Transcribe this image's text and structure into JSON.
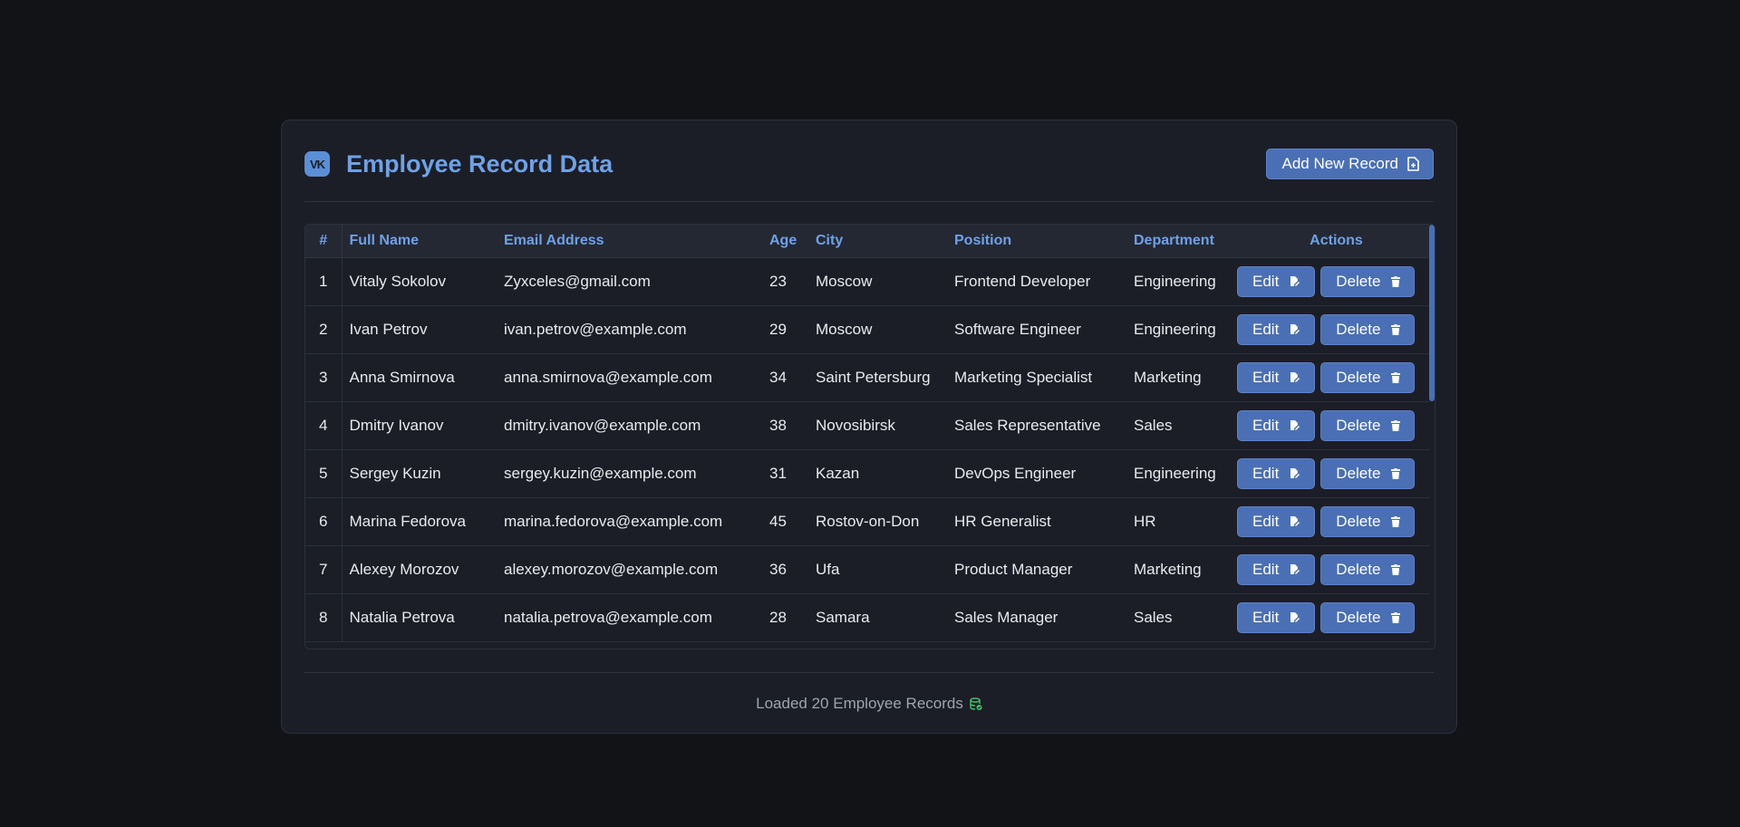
{
  "header": {
    "logo_text": "VK",
    "title": "Employee Record Data",
    "add_button_label": "Add New Record"
  },
  "table": {
    "columns": [
      "#",
      "Full Name",
      "Email Address",
      "Age",
      "City",
      "Position",
      "Department",
      "Actions"
    ],
    "edit_label": "Edit",
    "delete_label": "Delete",
    "rows": [
      {
        "num": "1",
        "name": "Vitaly Sokolov",
        "email": "Zyxceles@gmail.com",
        "age": "23",
        "city": "Moscow",
        "position": "Frontend Developer",
        "department": "Engineering"
      },
      {
        "num": "2",
        "name": "Ivan Petrov",
        "email": "ivan.petrov@example.com",
        "age": "29",
        "city": "Moscow",
        "position": "Software Engineer",
        "department": "Engineering"
      },
      {
        "num": "3",
        "name": "Anna Smirnova",
        "email": "anna.smirnova@example.com",
        "age": "34",
        "city": "Saint Petersburg",
        "position": "Marketing Specialist",
        "department": "Marketing"
      },
      {
        "num": "4",
        "name": "Dmitry Ivanov",
        "email": "dmitry.ivanov@example.com",
        "age": "38",
        "city": "Novosibirsk",
        "position": "Sales Representative",
        "department": "Sales"
      },
      {
        "num": "5",
        "name": "Sergey Kuzin",
        "email": "sergey.kuzin@example.com",
        "age": "31",
        "city": "Kazan",
        "position": "DevOps Engineer",
        "department": "Engineering"
      },
      {
        "num": "6",
        "name": "Marina Fedorova",
        "email": "marina.fedorova@example.com",
        "age": "45",
        "city": "Rostov-on-Don",
        "position": "HR Generalist",
        "department": "HR"
      },
      {
        "num": "7",
        "name": "Alexey Morozov",
        "email": "alexey.morozov@example.com",
        "age": "36",
        "city": "Ufa",
        "position": "Product Manager",
        "department": "Marketing"
      },
      {
        "num": "8",
        "name": "Natalia Petrova",
        "email": "natalia.petrova@example.com",
        "age": "28",
        "city": "Samara",
        "position": "Sales Manager",
        "department": "Sales"
      }
    ]
  },
  "footer": {
    "status_text": "Loaded 20 Employee Records",
    "status_icon": "database-check-icon"
  },
  "colors": {
    "accent": "#6fa1e6",
    "button": "#4a6fb5",
    "success": "#3ec46d",
    "background": "#121317",
    "card": "#1b1e26"
  }
}
